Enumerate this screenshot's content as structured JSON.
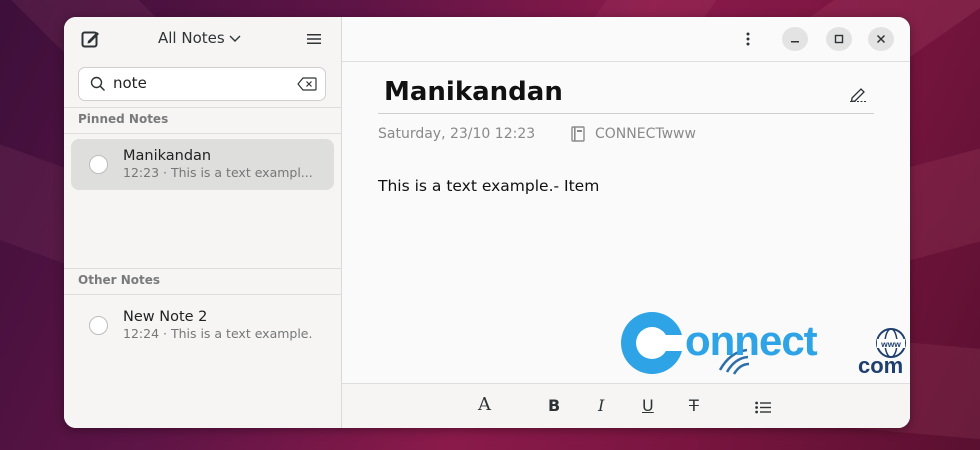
{
  "sidebar": {
    "notes_switch_label": "All Notes",
    "search": {
      "value": "note",
      "placeholder": ""
    },
    "sections": {
      "pinned": "Pinned Notes",
      "other": "Other Notes"
    },
    "pinned_notes": [
      {
        "title": "Manikandan",
        "subtitle": "12:23 · This is a text exampl..."
      }
    ],
    "other_notes": [
      {
        "title": "New Note 2",
        "subtitle": "12:24 · This is a text example."
      }
    ]
  },
  "note": {
    "title": "Manikandan",
    "date": "Saturday, 23/10 12:23",
    "notebook": "CONNECTwww",
    "body": "This is a text example.- Item"
  },
  "icons": {
    "new_note": "new-note-icon",
    "menu": "hamburger-menu-icon",
    "search": "search-icon",
    "clear": "backspace-clear-icon",
    "more": "vertical-dots-icon",
    "edit_title": "pencil-icon",
    "notebook": "notebook-icon",
    "minimize": "minimize-icon",
    "maximize": "maximize-icon",
    "close": "close-icon"
  },
  "toolbar": {
    "font": "A",
    "bold": "B",
    "italic": "I",
    "underline": "U",
    "strikethrough": "T"
  },
  "watermark": {
    "brand": "Connect",
    "suffix": "com",
    "globe_text": "www"
  },
  "colors": {
    "accent_blue": "#2ea3e6",
    "window_bg": "#fafafa",
    "sidebar_bg": "#f6f5f4"
  }
}
